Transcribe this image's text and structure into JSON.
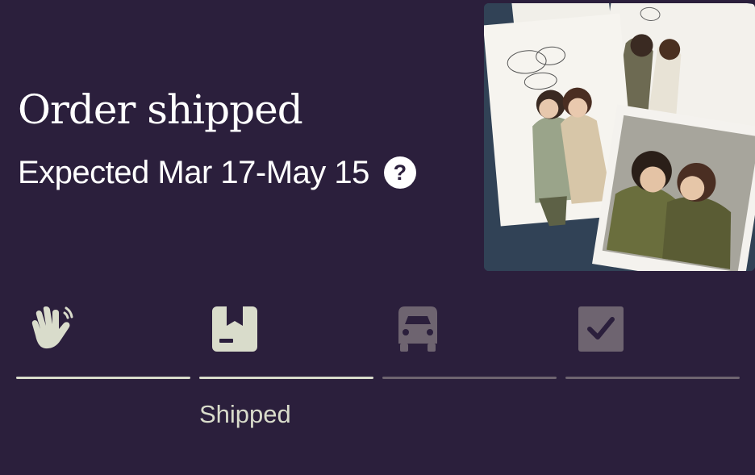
{
  "order": {
    "title": "Order shipped",
    "expected": "Expected Mar 17-May 15",
    "help_icon_glyph": "?"
  },
  "colors": {
    "background": "#2b1f3c",
    "active": "#d9dccb",
    "inactive": "#6e6470",
    "text": "#ffffff"
  },
  "steps": [
    {
      "icon": "wave-hand-icon",
      "label": "",
      "active": true
    },
    {
      "icon": "package-icon",
      "label": "Shipped",
      "active": true
    },
    {
      "icon": "truck-icon",
      "label": "",
      "active": false
    },
    {
      "icon": "checkbox-icon",
      "label": "",
      "active": false
    }
  ]
}
